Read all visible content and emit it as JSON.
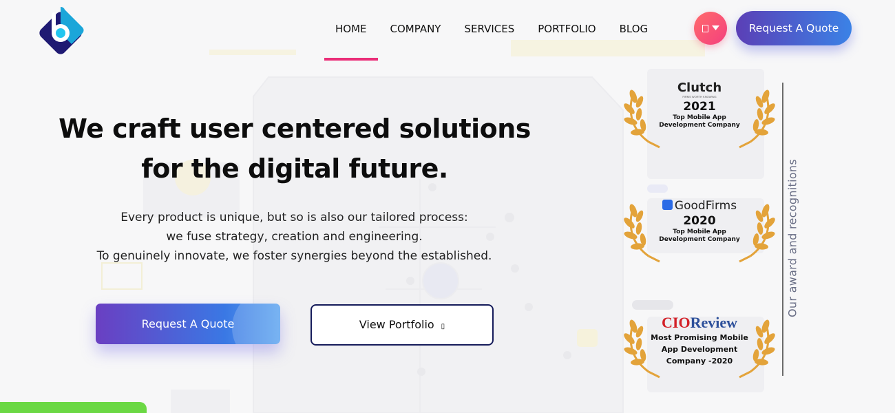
{
  "header": {
    "nav": [
      "HOME",
      "COMPANY",
      "SERVICES",
      "PORTFOLIO",
      "BLOG"
    ],
    "active_nav": "HOME",
    "quote_button": "Request A Quote",
    "language_icon": "flag-icon",
    "dropdown_icon": "caret-down-icon"
  },
  "hero": {
    "title_line1": "We craft user centered solutions",
    "title_line2": "for the digital future.",
    "subtitle_line1": "Every product is unique, but so is also our tailored process:",
    "subtitle_line2": "we fuse strategy, creation and engineering.",
    "subtitle_line3": "To genuinely innovate, we foster synergies beyond the established.",
    "primary_button": "Request A Quote",
    "secondary_button": "View Portfolio",
    "secondary_icon": "arrow-right-icon"
  },
  "awards": {
    "side_label": "Our award and recognitions",
    "items": [
      {
        "brand": "Clutch",
        "brand_sub": "FIRMS WORTH KNOWING",
        "year": "2021",
        "line1": "Top Mobile App",
        "line2": "Development Company"
      },
      {
        "brand": "GoodFirms",
        "year": "2020",
        "line1": "Top Mobile App",
        "line2": "Development Company"
      },
      {
        "brand_cio": "CIO",
        "brand_review": "Review",
        "line1": "Most Promising Mobile",
        "line2": "App Development",
        "line3": "Company -2020"
      }
    ]
  },
  "colors": {
    "accent_pink": "#ea2e78",
    "button_gradient_start": "#5b3fb6",
    "button_gradient_end": "#3b82e6",
    "laurel_gold": "#e3a33a",
    "green_tab": "#6bd844",
    "navy_border": "#151b5a"
  }
}
